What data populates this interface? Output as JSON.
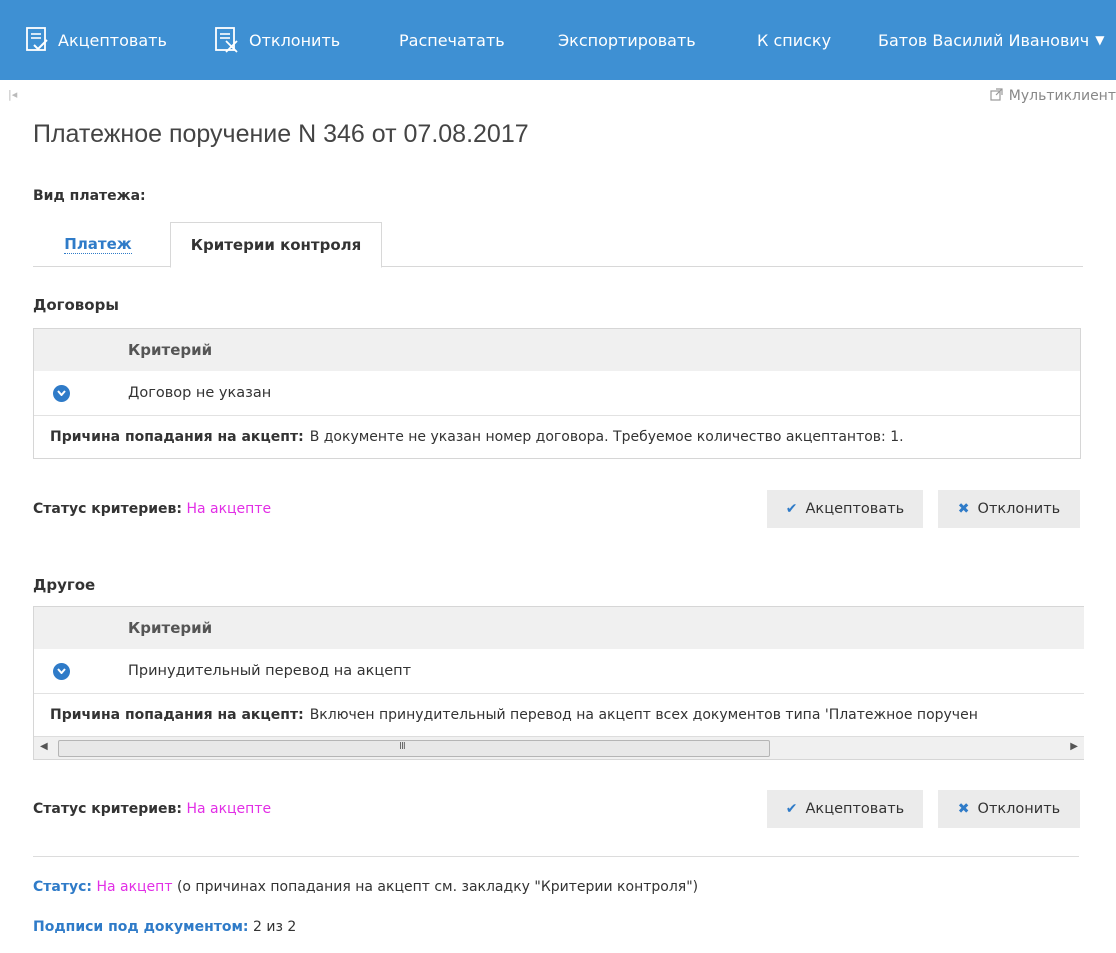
{
  "toolbar": {
    "accept_label": "Акцептовать",
    "reject_label": "Отклонить",
    "print_label": "Распечатать",
    "export_label": "Экспортировать",
    "to_list_label": "К списку",
    "user_name": "Батов Василий Иванович",
    "accent_color": "#3e90d3"
  },
  "multiclient_label": "Мультиклиент",
  "title": "Платежное поручение N 346 от 07.08.2017",
  "payment_type_label": "Вид платежа:",
  "tabs": [
    {
      "label": "Платеж"
    },
    {
      "label": "Критерии контроля"
    }
  ],
  "sections": [
    {
      "title": "Договоры",
      "column_header": "Критерий",
      "criterion": "Договор не указан",
      "reason_label": "Причина попадания на акцепт:",
      "reason_text": "В документе не указан номер договора. Требуемое количество акцептантов: 1.",
      "status_label": "Статус критериев:",
      "status_value": "На акцепте",
      "accept_button": "Акцептовать",
      "reject_button": "Отклонить"
    },
    {
      "title": "Другое",
      "column_header": "Критерий",
      "criterion": "Принудительный перевод на акцепт",
      "reason_label": "Причина попадания на акцепт:",
      "reason_text": "Включен принудительный перевод на акцепт всех документов типа 'Платежное поручен",
      "status_label": "Статус критериев:",
      "status_value": "На акцепте",
      "accept_button": "Акцептовать",
      "reject_button": "Отклонить"
    }
  ],
  "footer": {
    "status_label": "Статус:",
    "status_value": "На акцепт",
    "status_note": "(о причинах попадания на акцепт см. закладку \"Критерии контроля\")",
    "signatures_label": "Подписи под документом:",
    "signatures_value": "2 из 2"
  },
  "colors": {
    "status_magenta": "#e22fe6",
    "link_blue": "#2f7bc8"
  }
}
